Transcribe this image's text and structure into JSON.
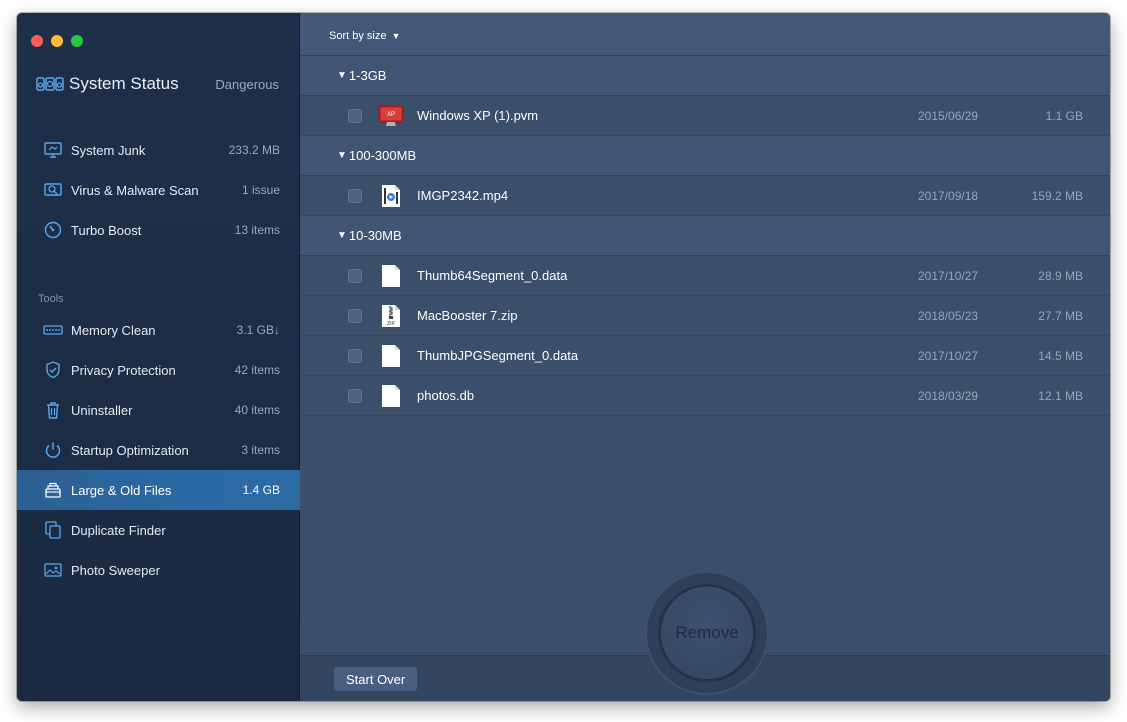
{
  "sidebar": {
    "status": {
      "title": "System Status",
      "value": "Dangerous"
    },
    "items": [
      {
        "label": "System Junk",
        "value": "233.2 MB",
        "icon": "monitor-icon"
      },
      {
        "label": "Virus & Malware Scan",
        "value": "1 issue",
        "icon": "virus-scan-icon"
      },
      {
        "label": "Turbo Boost",
        "value": "13 items",
        "icon": "speedometer-icon"
      }
    ],
    "tools_label": "Tools",
    "tools": [
      {
        "label": "Memory Clean",
        "value": "3.1 GB↓",
        "icon": "memory-chip-icon"
      },
      {
        "label": "Privacy Protection",
        "value": "42 items",
        "icon": "shield-icon"
      },
      {
        "label": "Uninstaller",
        "value": "40 items",
        "icon": "trash-icon"
      },
      {
        "label": "Startup Optimization",
        "value": "3 items",
        "icon": "power-icon"
      },
      {
        "label": "Large & Old Files",
        "value": "1.4 GB",
        "icon": "file-stack-icon",
        "active": true
      },
      {
        "label": "Duplicate Finder",
        "value": "",
        "icon": "duplicate-icon"
      },
      {
        "label": "Photo Sweeper",
        "value": "",
        "icon": "photo-icon"
      }
    ]
  },
  "main": {
    "sort_label": "Sort by size",
    "groups": [
      {
        "label": "1-3GB",
        "files": [
          {
            "name": "Windows XP (1).pvm",
            "date": "2015/06/29",
            "size": "1.1 GB",
            "icon": "parallels-vm-icon"
          }
        ]
      },
      {
        "label": "100-300MB",
        "files": [
          {
            "name": "IMGP2342.mp4",
            "date": "2017/09/18",
            "size": "159.2 MB",
            "icon": "video-file-icon"
          }
        ]
      },
      {
        "label": "10-30MB",
        "files": [
          {
            "name": "Thumb64Segment_0.data",
            "date": "2017/10/27",
            "size": "28.9 MB",
            "icon": "document-icon"
          },
          {
            "name": "MacBooster 7.zip",
            "date": "2018/05/23",
            "size": "27.7 MB",
            "icon": "zip-file-icon"
          },
          {
            "name": "ThumbJPGSegment_0.data",
            "date": "2017/10/27",
            "size": "14.5 MB",
            "icon": "document-icon"
          },
          {
            "name": "photos.db",
            "date": "2018/03/29",
            "size": "12.1 MB",
            "icon": "document-icon"
          }
        ]
      }
    ],
    "start_over_label": "Start Over",
    "remove_label": "Remove",
    "zip_badge": "ZIP",
    "vm_badge": "XP"
  },
  "colors": {
    "sidebar_bg": "#1f2f49",
    "main_bg": "#3b4e6a",
    "active_item": "#2a6aa4",
    "icon_blue": "#5ba6e8"
  }
}
